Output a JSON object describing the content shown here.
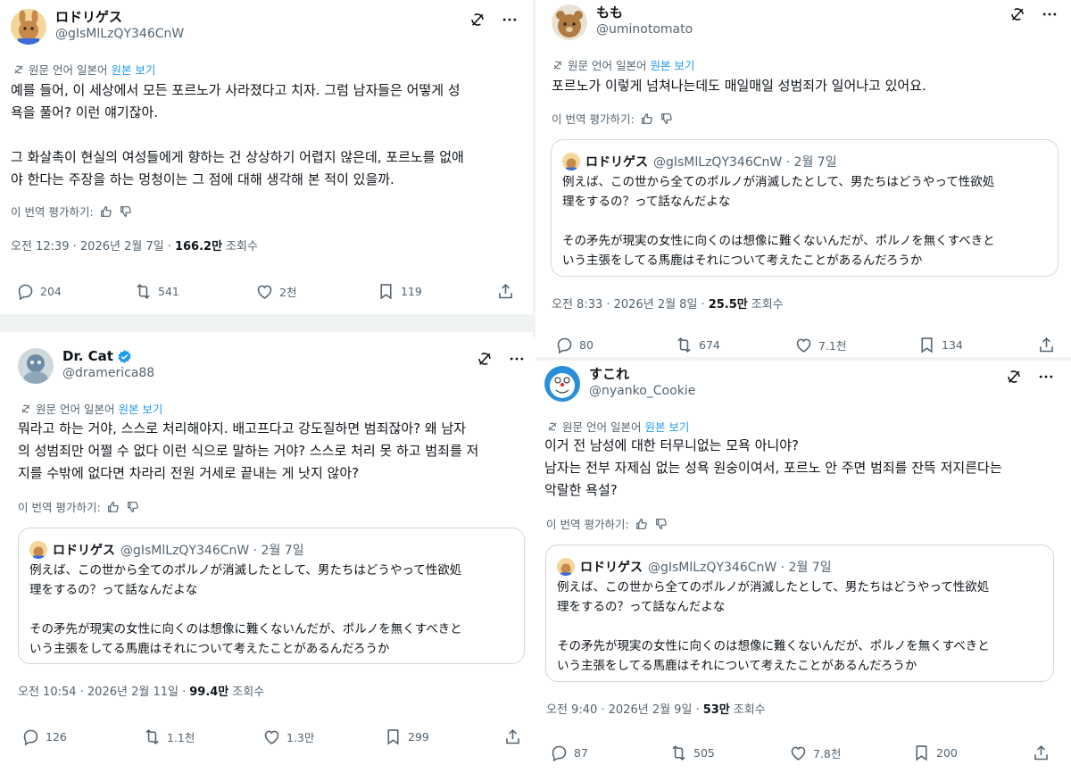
{
  "tweets": {
    "t1": {
      "name": "ロドリゲス",
      "handle": "@gIsMlLzQY346CnW",
      "translate": {
        "from": "원문 언어 일본어",
        "show": "원본 보기"
      },
      "text": "예를 들어, 이 세상에서 모든 포르노가 사라졌다고 치자. 그럼 남자들은 어떻게 성\n욕을 풀어? 이런 얘기잖아.\n\n그 화살촉이 현실의 여성들에게 향하는 건 상상하기 어렵지 않은데, 포르노를 없애\n야 한다는 주장을 하는 멍청이는 그 점에 대해 생각해 본 적이 있을까.",
      "rate": "이 번역 평가하기:",
      "time": "오전 12:39 · 2026년 2월 7일 ·",
      "views": "166.2만",
      "views_label": "조회수",
      "replies": "204",
      "reposts": "541",
      "likes": "2천",
      "bookmarks": "119"
    },
    "t2": {
      "name": "もも",
      "handle": "@uminotomato",
      "translate": {
        "from": "원문 언어 일본어",
        "show": "원본 보기"
      },
      "text": "포르노가 이렇게 넘쳐나는데도 매일매일 성범죄가 일어나고 있어요.",
      "rate": "이 번역 평가하기:",
      "quote": {
        "name": "ロドリゲス",
        "handle": "@gIsMlLzQY346CnW · 2월 7일",
        "text": "例えば、この世から全てのポルノが消滅したとして、男たちはどうやって性欲処\n理をするの？って話なんだよな\n\nその矛先が現実の女性に向くのは想像に難くないんだが、ポルノを無くすべきと\nいう主張をしてる馬鹿はそれについて考えたことがあるんだろうか"
      },
      "time": "오전 8:33 · 2026년 2월 8일 ·",
      "views": "25.5만",
      "views_label": "조회수",
      "replies": "80",
      "reposts": "674",
      "likes": "7.1천",
      "bookmarks": "134"
    },
    "t3": {
      "name": "Dr. Cat",
      "handle": "@dramerica88",
      "translate": {
        "from": "원문 언어 일본어",
        "show": "원본 보기"
      },
      "text": "뭐라고 하는 거야, 스스로 처리해야지. 배고프다고 강도질하면 범죄잖아? 왜 남자\n의 성범죄만 어쩔 수 없다 이런 식으로 말하는 거야? 스스로 처리 못 하고 범죄를 저\n지를 수밖에 없다면 차라리 전원 거세로 끝내는 게 낫지 않아?",
      "rate": "이 번역 평가하기:",
      "quote": {
        "name": "ロドリゲス",
        "handle": "@gIsMlLzQY346CnW · 2월 7일",
        "text": "例えば、この世から全てのポルノが消滅したとして、男たちはどうやって性欲処\n理をするの？って話なんだよな\n\nその矛先が現実の女性に向くのは想像に難くないんだが、ポルノを無くすべきと\nいう主張をしてる馬鹿はそれについて考えたことがあるんだろうか"
      },
      "time": "오전 10:54 · 2026년 2월 11일 ·",
      "views": "99.4만",
      "views_label": "조회수",
      "replies": "126",
      "reposts": "1.1천",
      "likes": "1.3만",
      "bookmarks": "299"
    },
    "t4": {
      "name": "すこれ",
      "handle": "@nyanko_Cookie",
      "translate": {
        "from": "원문 언어 일본어",
        "show": "원본 보기"
      },
      "text": "이거 전 남성에 대한 터무니없는 모욕 아니야?\n남자는 전부 자제심 없는 성욕 원숭이여서, 포르노 안 주면 범죄를 잔뜩 저지른다는\n악랄한 욕설?",
      "rate": "이 번역 평가하기:",
      "quote": {
        "name": "ロドリゲス",
        "handle": "@gIsMlLzQY346CnW · 2월 7일",
        "text": "例えば、この世から全てのポルノが消滅したとして、男たちはどうやって性欲処\n理をするの？って話なんだよな\n\nその矛先が現実の女性に向くのは想像に難くないんだが、ポルノを無くすべきと\nいう主張をしてる馬鹿はそれについて考えたことがあるんだろうか"
      },
      "time": "오전 9:40 · 2026년 2월 9일 ·",
      "views": "53만",
      "views_label": "조회수",
      "replies": "87",
      "reposts": "505",
      "likes": "7.8천",
      "bookmarks": "200"
    }
  },
  "colors": {
    "accent": "#1d9bf0",
    "muted": "#536471",
    "border": "#cfd9de"
  }
}
